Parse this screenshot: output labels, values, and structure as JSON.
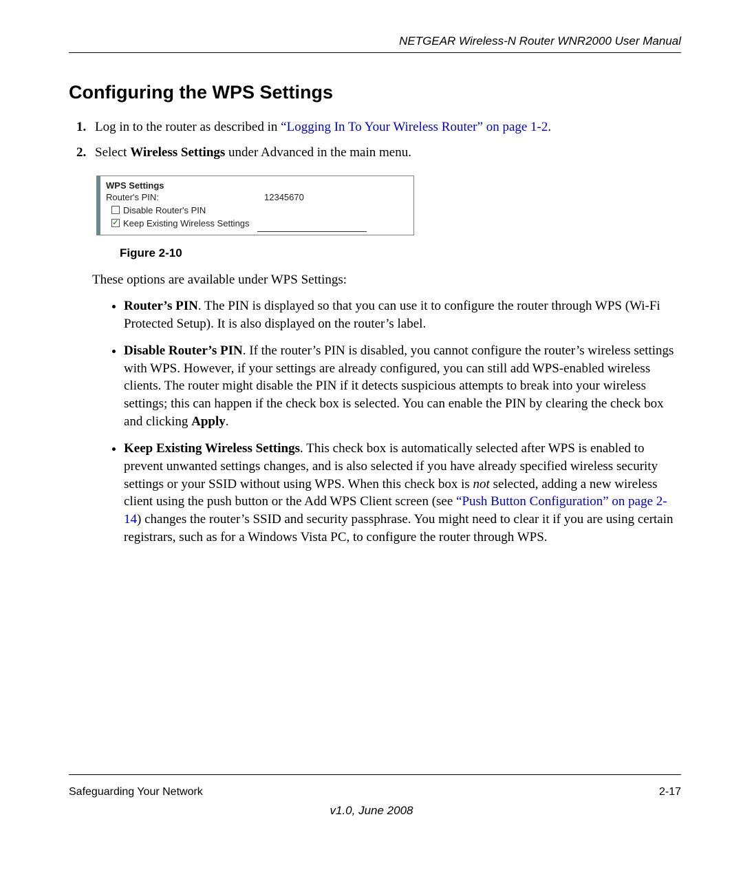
{
  "header": {
    "running": "NETGEAR Wireless-N Router WNR2000 User Manual"
  },
  "title": "Configuring the WPS Settings",
  "steps": {
    "s1_pre": "Log in to the router as described in ",
    "s1_link": "“Logging In To Your Wireless Router” on page 1-2",
    "s1_post": ".",
    "s2_pre": "Select ",
    "s2_bold": "Wireless Settings",
    "s2_post": " under Advanced in the main menu."
  },
  "figure": {
    "heading": "WPS Settings",
    "pin_label": "Router's PIN:",
    "pin_value": "12345670",
    "opt_disable": "Disable Router's PIN",
    "opt_keep": "Keep Existing Wireless Settings",
    "caption": "Figure 2-10"
  },
  "intro_para": "These options are available under WPS Settings:",
  "bullets": {
    "b1_bold": "Router’s PIN",
    "b1_text": ". The PIN is displayed so that you can use it to configure the router through WPS (Wi-Fi Protected Setup). It is also displayed on the router’s label.",
    "b2_bold": "Disable Router’s PIN",
    "b2_text": ". If the router’s PIN is disabled, you cannot configure the router’s wireless settings with WPS. However, if your settings are already configured, you can still add WPS-enabled wireless clients. The router might disable the PIN if it detects suspicious attempts to break into your wireless settings; this can happen if the check box is selected. You can enable the PIN by clearing the check box and clicking ",
    "b2_apply": "Apply",
    "b2_after": ".",
    "b3_bold": "Keep Existing Wireless Settings",
    "b3_t1": ". This check box is automatically selected after WPS is enabled to prevent unwanted settings changes, and is also selected if you have already specified wireless security settings or your SSID without using WPS. When this check box is ",
    "b3_em": "not",
    "b3_t2": " selected, adding a new wireless client using the push button or the Add WPS Client screen (see ",
    "b3_link": "“Push Button Configuration” on page 2-14",
    "b3_t3": ") changes the router’s SSID and security passphrase. You might need to clear it if you are using certain registrars, such as for a Windows Vista PC, to configure the router through WPS."
  },
  "footer": {
    "left": "Safeguarding Your Network",
    "right": "2-17",
    "version": "v1.0, June 2008"
  }
}
